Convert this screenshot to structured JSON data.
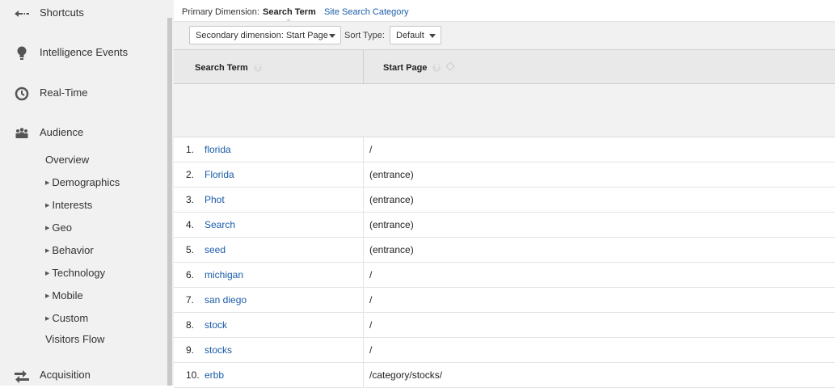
{
  "sidebar": {
    "shortcuts": "Shortcuts",
    "intelligence_events": "Intelligence Events",
    "real_time": "Real-Time",
    "audience": "Audience",
    "overview": "Overview",
    "demographics": "Demographics",
    "interests": "Interests",
    "geo": "Geo",
    "behavior": "Behavior",
    "technology": "Technology",
    "mobile": "Mobile",
    "custom": "Custom",
    "visitors_flow": "Visitors Flow",
    "acquisition": "Acquisition"
  },
  "dimension_bar": {
    "label": "Primary Dimension:",
    "active": "Search Term",
    "alternative": "Site Search Category"
  },
  "controls": {
    "secondary_dimension": "Secondary dimension: Start Page",
    "sort_type_label": "Sort Type:",
    "sort_type_value": "Default"
  },
  "table": {
    "col_search_term": "Search Term",
    "col_start_page": "Start Page",
    "help_glyph": "?",
    "rows": [
      {
        "num": "1.",
        "term": "florida",
        "page": "/"
      },
      {
        "num": "2.",
        "term": "Florida",
        "page": "(entrance)"
      },
      {
        "num": "3.",
        "term": "Phot",
        "page": "(entrance)"
      },
      {
        "num": "4.",
        "term": "Search",
        "page": "(entrance)"
      },
      {
        "num": "5.",
        "term": "seed",
        "page": "(entrance)"
      },
      {
        "num": "6.",
        "term": "michigan",
        "page": "/"
      },
      {
        "num": "7.",
        "term": "san diego",
        "page": "/"
      },
      {
        "num": "8.",
        "term": "stock",
        "page": "/"
      },
      {
        "num": "9.",
        "term": "stocks",
        "page": "/"
      },
      {
        "num": "10.",
        "term": "erbb",
        "page": "/category/stocks/"
      }
    ]
  },
  "colors": {
    "link": "#1a5ca8",
    "sidebar_bg": "#f1f1f1",
    "header_bg": "#e9e9e9"
  }
}
